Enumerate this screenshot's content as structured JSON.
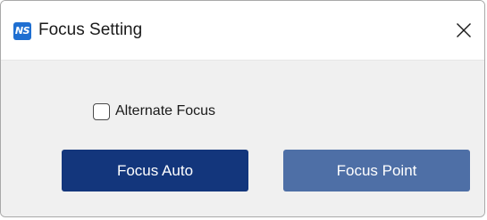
{
  "window": {
    "title": "Focus Setting",
    "logo_text": "NS",
    "logo_icon": "ns-app-logo-icon",
    "close_icon": "close-icon"
  },
  "options": {
    "alternate_focus_label": "Alternate Focus",
    "alternate_focus_checked": false
  },
  "buttons": {
    "focus_auto_label": "Focus Auto",
    "focus_point_label": "Focus Point"
  },
  "colors": {
    "focus_auto_bg": "#13367c",
    "focus_point_bg": "#4e6fa6",
    "logo_bg": "#1f6fd1"
  }
}
